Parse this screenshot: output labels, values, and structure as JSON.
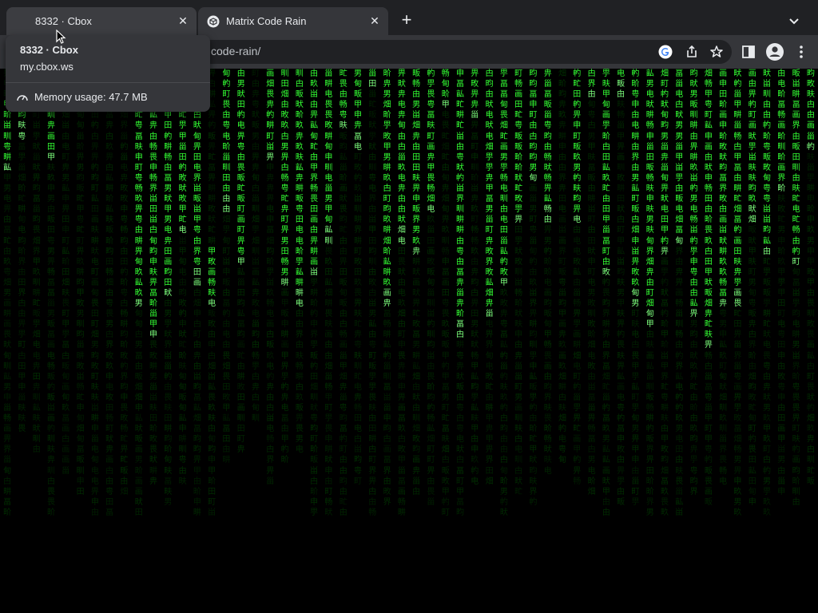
{
  "tabs": [
    {
      "title": "8332 · Cbox",
      "close_icon": "close-icon"
    },
    {
      "title": "Matrix Code Rain",
      "close_icon": "close-icon",
      "favicon": "codepen-favicon"
    }
  ],
  "new_tab_label": "+",
  "omnibox": {
    "url_visible": "code-rain/"
  },
  "hovercard": {
    "title": "8332 · Cbox",
    "domain": "my.cbox.ws",
    "memory": "Memory usage: 47.7 MB"
  },
  "colors": {
    "rain": "#33ff33",
    "background": "#000000",
    "chrome_dark": "#202124",
    "chrome_toolbar": "#35363a"
  },
  "matrix": {
    "charset": "田由甲申甴电甶男甸甹町画甼甽甾甿畀畁畂畃畄畅畆畇畈畉畊畋界畍畎畏畐畑",
    "columns": [
      {
        "fill": 0.58,
        "bright": [
          0.05,
          0.22
        ]
      },
      {
        "fill": 0.48,
        "bright": [
          0.05,
          0.14
        ]
      },
      {
        "fill": 0.51,
        "bright": []
      },
      {
        "fill": 0.59,
        "bright": [
          0.05,
          0.2
        ]
      },
      {
        "fill": 0.53,
        "bright": []
      },
      {
        "fill": 0.56,
        "bright": []
      },
      {
        "fill": 0.58,
        "bright": []
      },
      {
        "fill": 0.58,
        "bright": []
      },
      {
        "fill": 0.56,
        "bright": [
          0.0,
          0.06
        ]
      },
      {
        "fill": 0.59,
        "bright": [
          0.0,
          0.52
        ]
      },
      {
        "fill": 0.54,
        "bright": [
          0.0,
          0.59
        ]
      },
      {
        "fill": 0.57,
        "bright": [
          0.0,
          0.49
        ]
      },
      {
        "fill": 0.54,
        "bright": [
          0.0,
          0.36
        ]
      },
      {
        "fill": 0.58,
        "bright": [
          0.0,
          0.46
        ]
      },
      {
        "fill": 0.58,
        "bright": [
          0.38,
          0.52
        ]
      },
      {
        "fill": 0.52,
        "bright": [
          0.0,
          0.3
        ]
      },
      {
        "fill": 0.51,
        "bright": [
          0.0,
          0.43
        ]
      },
      {
        "fill": 0.46,
        "bright": []
      },
      {
        "fill": 0.55,
        "bright": [
          0.0,
          0.19
        ]
      },
      {
        "fill": 0.52,
        "bright": [
          0.0,
          0.47
        ]
      },
      {
        "fill": 0.51,
        "bright": [
          0.0,
          0.5
        ]
      },
      {
        "fill": 0.58,
        "bright": [
          0.0,
          0.44
        ]
      },
      {
        "fill": 0.59,
        "bright": [
          0.0,
          0.37
        ]
      },
      {
        "fill": 0.58,
        "bright": [
          0.0,
          0.13
        ]
      },
      {
        "fill": 0.55,
        "bright": [
          0.0,
          0.16
        ]
      },
      {
        "fill": 0.58,
        "bright": [
          0.0,
          0.03
        ]
      },
      {
        "fill": 0.57,
        "bright": [
          0.0,
          0.5
        ]
      },
      {
        "fill": 0.58,
        "bright": [
          0.0,
          0.37
        ]
      },
      {
        "fill": 0.56,
        "bright": [
          0.0,
          0.4
        ]
      },
      {
        "fill": 0.57,
        "bright": [
          0.0,
          0.31
        ]
      },
      {
        "fill": 0.58,
        "bright": [
          0.0,
          0.08
        ]
      },
      {
        "fill": 0.59,
        "bright": [
          0.0,
          0.57
        ]
      },
      {
        "fill": 0.55,
        "bright": [
          0.0,
          0.1
        ]
      },
      {
        "fill": 0.54,
        "bright": [
          0.0,
          0.54
        ]
      },
      {
        "fill": 0.58,
        "bright": [
          0.0,
          0.47
        ]
      },
      {
        "fill": 0.56,
        "bright": [
          0.0,
          0.33
        ]
      },
      {
        "fill": 0.57,
        "bright": [
          0.0,
          0.24
        ]
      },
      {
        "fill": 0.53,
        "bright": [
          0.0,
          0.32
        ]
      },
      {
        "fill": 0.52,
        "bright": []
      },
      {
        "fill": 0.55,
        "bright": [
          0.0,
          0.34
        ]
      },
      {
        "fill": 0.56,
        "bright": [
          0.0,
          0.06
        ]
      },
      {
        "fill": 0.58,
        "bright": [
          0.0,
          0.45
        ]
      },
      {
        "fill": 0.57,
        "bright": [
          0.0,
          0.05
        ]
      },
      {
        "fill": 0.57,
        "bright": [
          0.0,
          0.5
        ]
      },
      {
        "fill": 0.58,
        "bright": [
          0.0,
          0.55
        ]
      },
      {
        "fill": 0.58,
        "bright": [
          0.0,
          0.4
        ]
      },
      {
        "fill": 0.59,
        "bright": [
          0.0,
          0.38
        ]
      },
      {
        "fill": 0.56,
        "bright": [
          0.0,
          0.53
        ]
      },
      {
        "fill": 0.57,
        "bright": [
          0.0,
          0.6
        ]
      },
      {
        "fill": 0.55,
        "bright": [
          0.0,
          0.52
        ]
      },
      {
        "fill": 0.58,
        "bright": [
          0.0,
          0.5
        ]
      },
      {
        "fill": 0.57,
        "bright": [
          0.0,
          0.32
        ]
      },
      {
        "fill": 0.58,
        "bright": [
          0.0,
          0.4
        ]
      },
      {
        "fill": 0.56,
        "bright": [
          0.0,
          0.27
        ]
      },
      {
        "fill": 0.57,
        "bright": [
          0.0,
          0.42
        ]
      },
      {
        "fill": 0.55,
        "bright": [
          0.0,
          0.18
        ]
      }
    ]
  }
}
